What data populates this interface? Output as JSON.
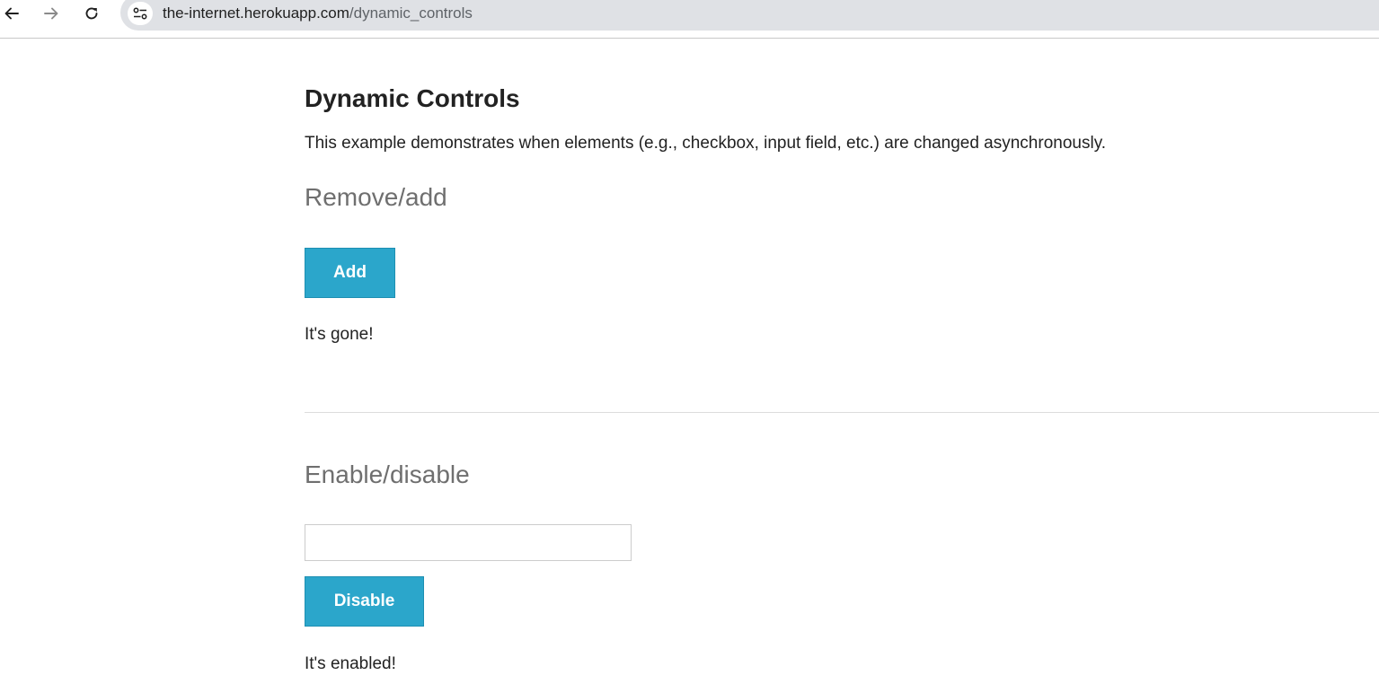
{
  "browser": {
    "url_host": "the-internet.herokuapp.com",
    "url_path": "/dynamic_controls",
    "icons": {
      "back": "arrow-left-icon",
      "forward": "arrow-right-icon",
      "reload": "reload-icon",
      "site_info": "tune-icon"
    }
  },
  "page": {
    "title": "Dynamic Controls",
    "description": "This example demonstrates when elements (e.g., checkbox, input field, etc.) are changed asynchronously.",
    "remove_add": {
      "heading": "Remove/add",
      "button_label": "Add",
      "message": "It's gone!"
    },
    "enable_disable": {
      "heading": "Enable/disable",
      "input_value": "",
      "button_label": "Disable",
      "message": "It's enabled!"
    }
  },
  "colors": {
    "button_bg": "#2ba6cb",
    "heading_gray": "#6f6f6f",
    "omnibox_bg": "#dfe1e5"
  }
}
